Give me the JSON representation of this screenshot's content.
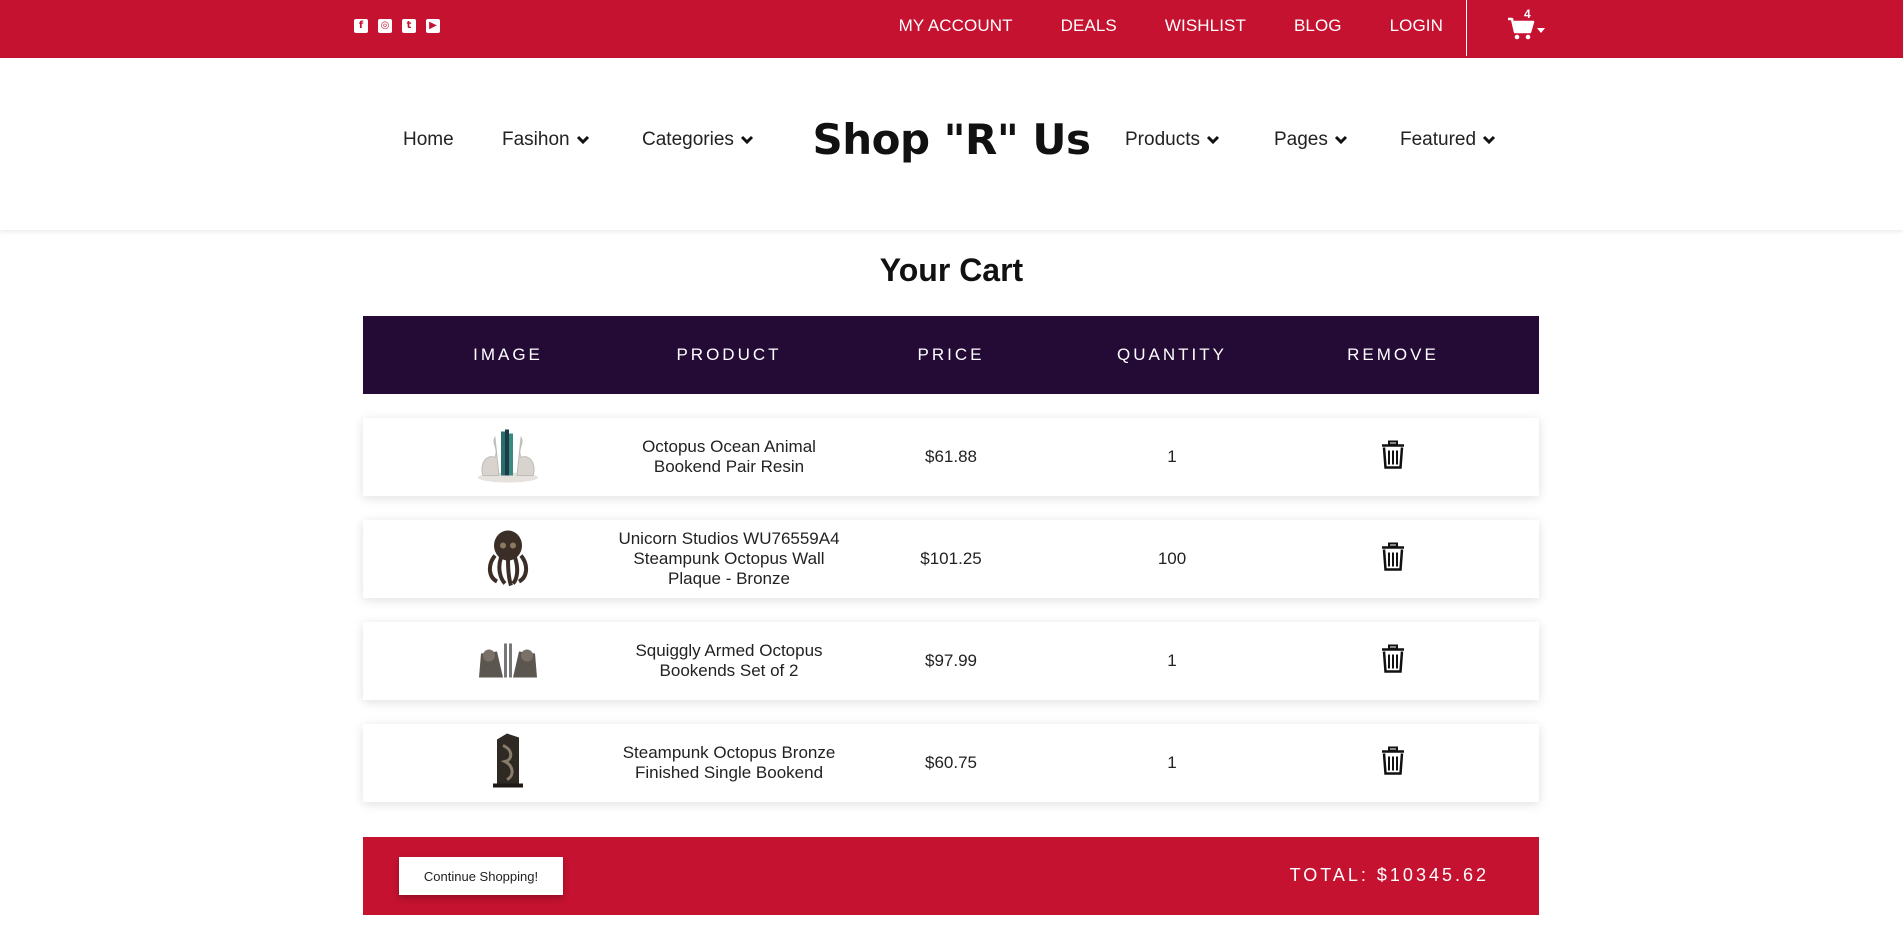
{
  "topbar": {
    "social": [
      {
        "icon": "facebook-icon",
        "glyph": "f"
      },
      {
        "icon": "instagram-icon",
        "glyph": "◎"
      },
      {
        "icon": "twitter-icon",
        "glyph": "t"
      },
      {
        "icon": "youtube-icon",
        "glyph": "▶"
      }
    ],
    "links": [
      "MY ACCOUNT",
      "DEALS",
      "WISHLIST",
      "BLOG",
      "LOGIN"
    ],
    "cart_count": "4"
  },
  "nav": {
    "left": [
      {
        "label": "Home",
        "dropdown": false
      },
      {
        "label": "Fasihon",
        "dropdown": true
      },
      {
        "label": "Categories",
        "dropdown": true
      }
    ],
    "brand": "Shop \"R\" Us",
    "right": [
      {
        "label": "Products",
        "dropdown": true
      },
      {
        "label": "Pages",
        "dropdown": true
      },
      {
        "label": "Featured",
        "dropdown": true
      }
    ]
  },
  "cart": {
    "title": "Your Cart",
    "headers": [
      "IMAGE",
      "PRODUCT",
      "PRICE",
      "QUANTITY",
      "REMOVE"
    ],
    "items": [
      {
        "name": "Octopus Ocean Animal Bookend Pair Resin",
        "price": "$61.88",
        "quantity": "1",
        "image": "bookend-pair-image"
      },
      {
        "name": "Unicorn Studios WU76559A4 Steampunk Octopus Wall Plaque - Bronze",
        "price": "$101.25",
        "quantity": "100",
        "image": "wall-plaque-image"
      },
      {
        "name": "Squiggly Armed Octopus Bookends Set of 2",
        "price": "$97.99",
        "quantity": "1",
        "image": "bookends-set-image"
      },
      {
        "name": "Steampunk Octopus Bronze Finished Single Bookend",
        "price": "$60.75",
        "quantity": "1",
        "image": "single-bookend-image"
      }
    ],
    "continue_label": "Continue Shopping!",
    "total_label": "TOTAL: $10345.62"
  },
  "colors": {
    "brand_red": "#c41230",
    "header_purple": "#230b35"
  }
}
